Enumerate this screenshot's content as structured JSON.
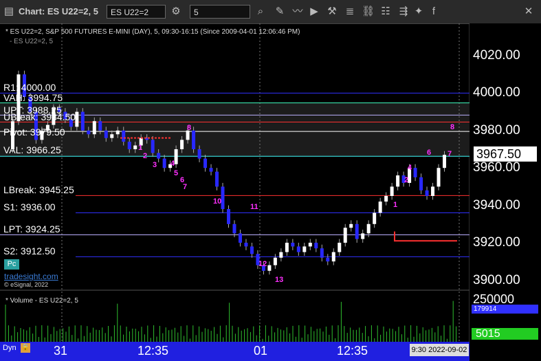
{
  "toolbar": {
    "title": "Chart: ES U22=2, 5",
    "symbol": "ES U22=2",
    "interval": "5",
    "icons": [
      "gear-icon",
      "search-icon",
      "edit-icon",
      "line-chart-icon",
      "play-icon",
      "tools-icon",
      "link-icon",
      "cursor-icon",
      "share-icon",
      "twitter-icon",
      "facebook-icon"
    ]
  },
  "chart": {
    "header": "* ES U22=2, S&P 500 FUTURES E-MINI (DAY), 5, 09:30-16:15 (Since 2009-04-01 12:06:46 PM)",
    "subheader": "- ES U22=2, 5",
    "current_price": "3967.50",
    "price_ticks": [
      "4020.00",
      "4000.00",
      "3980.00",
      "3960.00",
      "3940.00",
      "3920.00",
      "3900.00"
    ],
    "levels": [
      {
        "label": "R1: 4000.00",
        "color": "#3030ff"
      },
      {
        "label": "VAH: 3994.75",
        "color": "#40ffc0"
      },
      {
        "label": "UPT: 3988.25",
        "color": "#bbb0ff"
      },
      {
        "label": "UBreak: 3984.50",
        "color": "#ff3030"
      },
      {
        "label": "Pivot: 3979.50",
        "color": "#ffffff"
      },
      {
        "label": "VAL: 3966.25",
        "color": "#40ffff"
      },
      {
        "label": "LBreak: 3945.25",
        "color": "#ff3030"
      },
      {
        "label": "S1: 3936.00",
        "color": "#3030ff"
      },
      {
        "label": "LPT: 3924.25",
        "color": "#bbb0ff"
      },
      {
        "label": "S2: 3912.50",
        "color": "#3030ff"
      }
    ],
    "pc_label": "Pc",
    "logo": "tradesight.com",
    "credit": "© eSignal, 2022",
    "volume_title": "* Volume - ES U22=2, 5",
    "volume_ticks": [
      "250000",
      "179914",
      "5015"
    ],
    "time_labels": [
      "31",
      "12:35",
      "01",
      "12:35"
    ],
    "date_box": "9:30 2022-09-02",
    "dyn_label": "Dyn",
    "markers": [
      {
        "text": "1",
        "color": "#ff30ff"
      },
      {
        "text": "2",
        "color": "#ff30ff"
      },
      {
        "text": "3",
        "color": "#ff30ff"
      },
      {
        "text": "4",
        "color": "#ff30ff"
      },
      {
        "text": "5",
        "color": "#ff30ff"
      },
      {
        "text": "6",
        "color": "#ff30ff"
      },
      {
        "text": "7",
        "color": "#ff30ff"
      },
      {
        "text": "8",
        "color": "#ff30ff"
      },
      {
        "text": "10",
        "color": "#ff30ff"
      },
      {
        "text": "11",
        "color": "#ff30ff"
      },
      {
        "text": "12",
        "color": "#ff30ff"
      },
      {
        "text": "13",
        "color": "#ff30ff"
      },
      {
        "text": "1",
        "color": "#ff30ff"
      },
      {
        "text": "2",
        "color": "#ff30ff"
      },
      {
        "text": "4",
        "color": "#ff30ff"
      },
      {
        "text": "6",
        "color": "#ff30ff"
      },
      {
        "text": "7",
        "color": "#ff30ff"
      },
      {
        "text": "8",
        "color": "#ff30ff"
      }
    ]
  }
}
